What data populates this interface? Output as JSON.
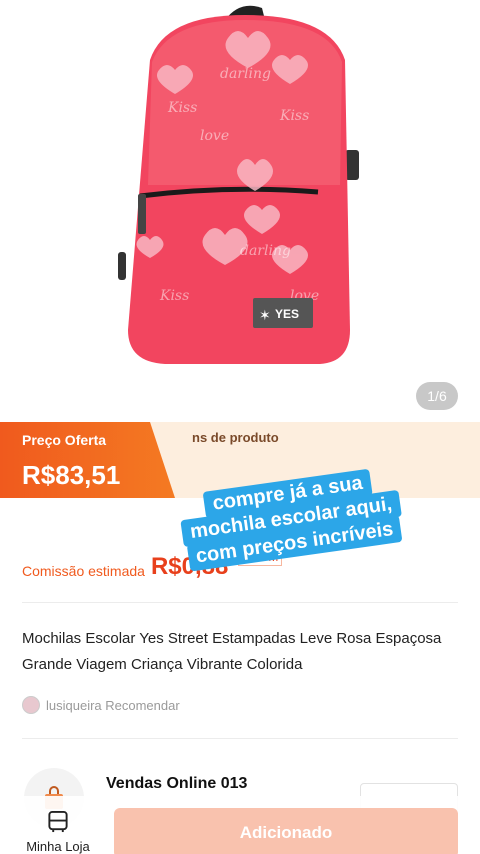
{
  "product": {
    "image_counter": "1/6",
    "image_description_icon": "backpack-icon",
    "brand_tag": "YES"
  },
  "price": {
    "label": "Preço Oferta",
    "value": "R$83,51",
    "benefit_partial": "ns de produto"
  },
  "commission": {
    "label": "Comissão estimada",
    "value": "R$0,88",
    "rate": "1%CM"
  },
  "title": "Mochilas Escolar Yes Street Estampadas Leve Rosa Espaçosa Grande Viagem Criança Vibrante Colorida",
  "recommend": {
    "text": "lusiqueira Recomendar"
  },
  "store": {
    "name": "Vendas Online 013"
  },
  "bottom": {
    "nav_label": "Minha Loja",
    "add_button": "Adicionado"
  },
  "caption": {
    "lines": [
      "compre já a sua",
      "mochila escolar aqui,",
      "com preços incríveis"
    ]
  },
  "colors": {
    "accent": "#f05a1e",
    "caption_bg": "#2ca6e8",
    "backpack": "#f2455f"
  }
}
